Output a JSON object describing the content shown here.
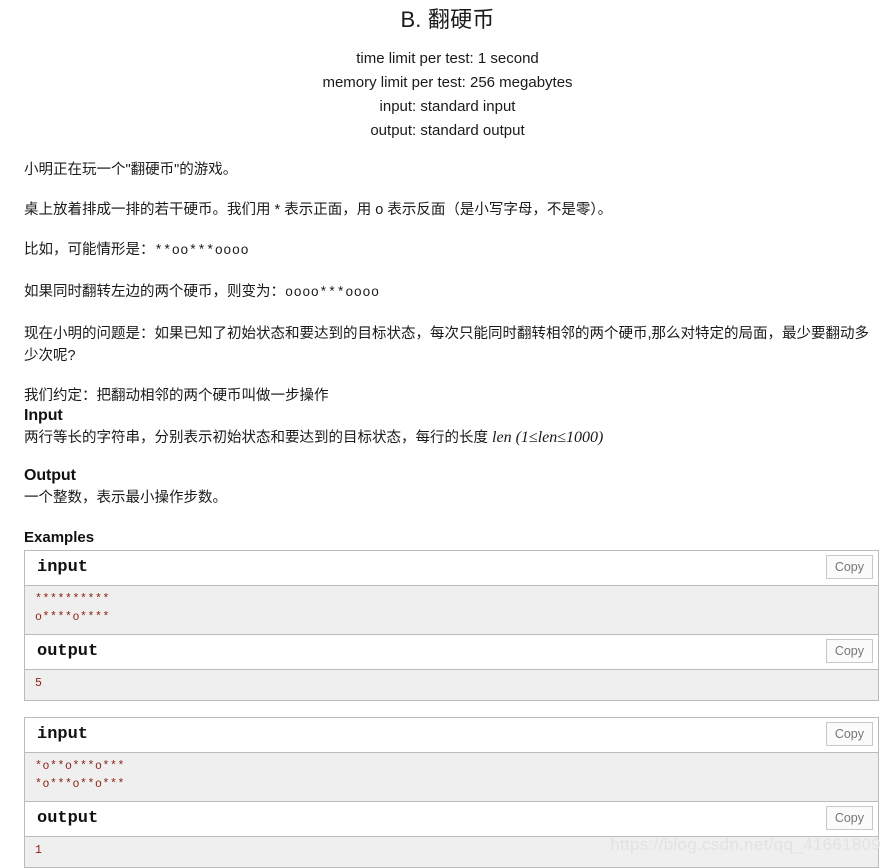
{
  "problem": {
    "title": "B. 翻硬币",
    "limits": [
      "time limit per test: 1 second",
      "memory limit per test: 256 megabytes",
      "input: standard input",
      "output: standard output"
    ]
  },
  "statement": {
    "p1": "小明正在玩一个\"翻硬币\"的游戏。",
    "p2": "桌上放着排成一排的若干硬币。我们用 * 表示正面，用 o 表示反面（是小写字母，不是零）。",
    "p3_prefix": "比如，可能情形是：",
    "p3_mono": "**oo***oooo",
    "p4_prefix": "如果同时翻转左边的两个硬币，则变为：",
    "p4_mono": "oooo***oooo",
    "p5": "现在小明的问题是：如果已知了初始状态和要达到的目标状态，每次只能同时翻转相邻的两个硬币,那么对特定的局面，最少要翻动多少次呢?",
    "p6": "我们约定：把翻动相邻的两个硬币叫做一步操作"
  },
  "input_section": {
    "heading": "Input",
    "text_before": "两行等长的字符串，分别表示初始状态和要达到的目标状态，每行的长度 ",
    "math_var": "len",
    "math_open": "(",
    "math_low": "1",
    "math_op1": "≤",
    "math_mid": "len",
    "math_op2": "≤",
    "math_high": "1000",
    "math_close": ")"
  },
  "output_section": {
    "heading": "Output",
    "text": "一个整数，表示最小操作步数。"
  },
  "examples": {
    "heading": "Examples",
    "copy_label": "Copy",
    "input_label": "input",
    "output_label": "output",
    "tests": [
      {
        "input": "**********\no****o****",
        "output": "5"
      },
      {
        "input": "*o**o***o***\n*o***o**o***",
        "output": "1"
      }
    ]
  },
  "watermark": "https://blog.csdn.net/qq_41661809",
  "colors": {
    "sample_text": "#8a1f11",
    "sample_bg": "#efefef",
    "border": "#bbbbbb",
    "copy_text": "#767676"
  }
}
